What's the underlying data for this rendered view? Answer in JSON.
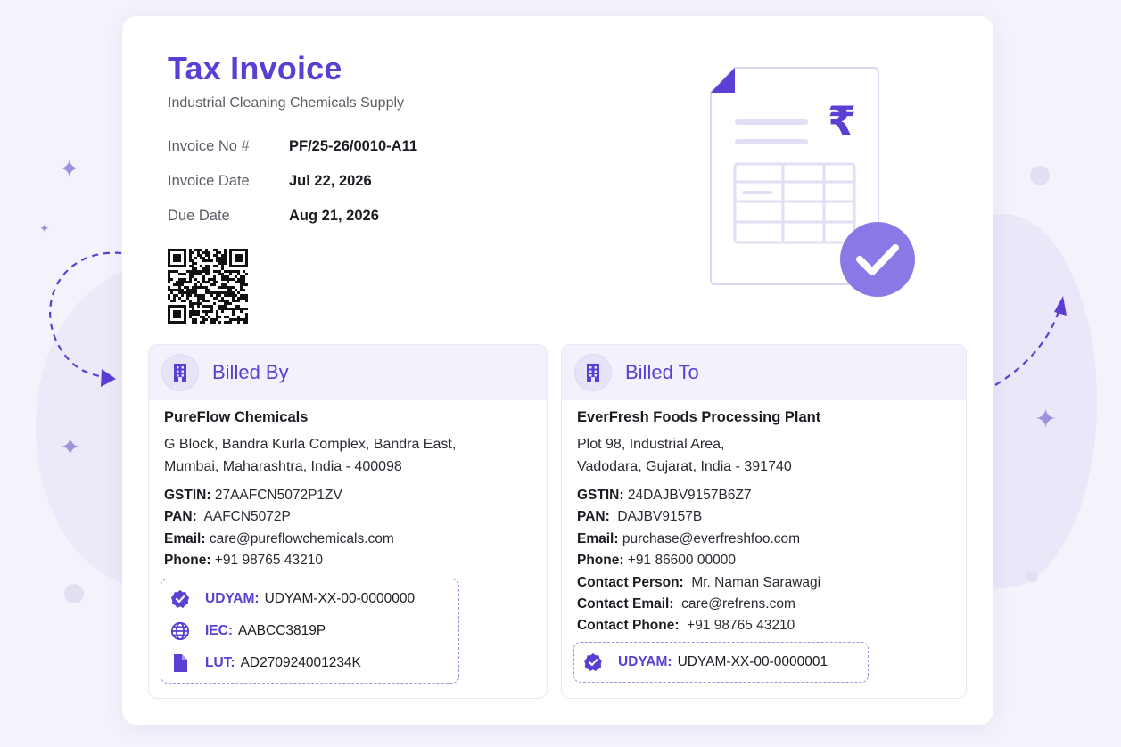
{
  "invoice": {
    "title": "Tax Invoice",
    "subtitle": "Industrial Cleaning Chemicals Supply",
    "meta": [
      {
        "label": "Invoice No #",
        "value": "PF/25-26/0010-A11"
      },
      {
        "label": "Invoice Date",
        "value": "Jul 22, 2026"
      },
      {
        "label": "Due Date",
        "value": "Aug 21, 2026"
      }
    ]
  },
  "billed_by": {
    "heading": "Billed By",
    "company": "PureFlow Chemicals",
    "address_line1": "G Block, Bandra Kurla Complex, Bandra East,",
    "address_line2": "Mumbai, Maharashtra, India - 400098",
    "gstin_label": "GSTIN:",
    "gstin": "27AAFCN5072P1ZV",
    "pan_label": "PAN:",
    "pan": "AAFCN5072P",
    "email_label": "Email:",
    "email": "care@pureflowchemicals.com",
    "phone_label": "Phone:",
    "phone": "+91 98765 43210",
    "ids": [
      {
        "icon": "verified-badge-icon",
        "label": "UDYAM:",
        "value": "UDYAM-XX-00-0000000"
      },
      {
        "icon": "globe-icon",
        "label": "IEC:",
        "value": "AABCC3819P"
      },
      {
        "icon": "document-icon",
        "label": "LUT:",
        "value": "AD270924001234K"
      }
    ]
  },
  "billed_to": {
    "heading": "Billed To",
    "company": "EverFresh Foods Processing Plant",
    "address_line1": "Plot 98, Industrial Area,",
    "address_line2": "Vadodara, Gujarat, India - 391740",
    "gstin_label": "GSTIN:",
    "gstin": "24DAJBV9157B6Z7",
    "pan_label": "PAN:",
    "pan": "DAJBV9157B",
    "email_label": "Email:",
    "email": "purchase@everfreshfoo.com",
    "phone_label": "Phone:",
    "phone": "+91 86600 00000",
    "contact_person_label": "Contact Person:",
    "contact_person": "Mr. Naman Sarawagi",
    "contact_email_label": "Contact Email:",
    "contact_email": "care@refrens.com",
    "contact_phone_label": "Contact Phone:",
    "contact_phone": "+91 98765 43210",
    "ids": [
      {
        "icon": "verified-badge-icon",
        "label": "UDYAM:",
        "value": "UDYAM-XX-00-0000001"
      }
    ]
  },
  "illustration": {
    "currency_symbol": "₹",
    "icons": [
      "invoice-document-icon",
      "check-circle-icon"
    ]
  },
  "colors": {
    "accent": "#5b3fd4",
    "panel_header_bg": "#f3f1fb",
    "dashed_border": "#9d92dc",
    "check_circle": "#8b78e6"
  }
}
